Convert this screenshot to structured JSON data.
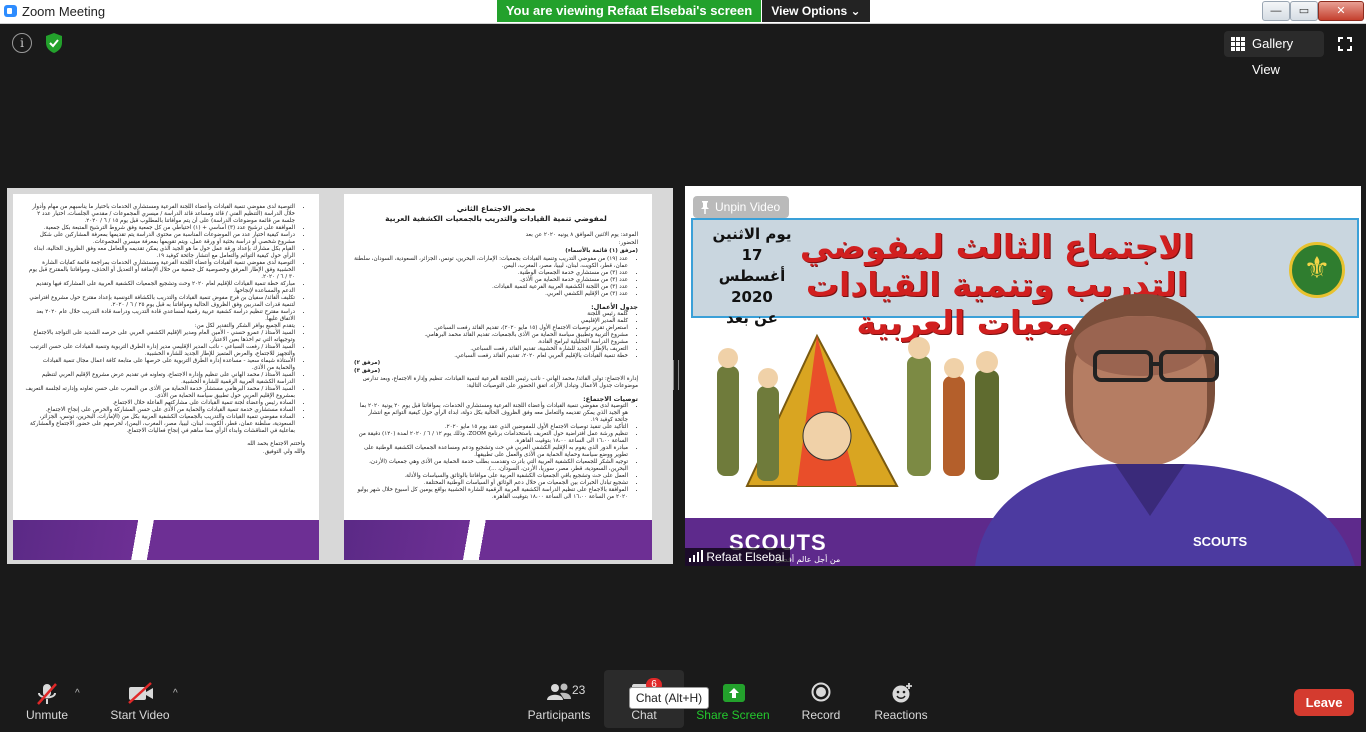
{
  "window": {
    "title": "Zoom Meeting",
    "viewing_banner": "You are viewing Refaat Elsebai's screen",
    "view_options": "View Options",
    "minimize": "—",
    "maximize": "▭",
    "close": "✕"
  },
  "top_bar": {
    "info_glyph": "i",
    "gallery_view": "Gallery View"
  },
  "document": {
    "heading_1": "محضر الاجتماع الثاني",
    "heading_2": "لمفوضي تنمية القيادات والتدريب بالجمعيات الكشفية العربية",
    "topic": "الموعد: يوم الاثنين الموافق ٨ يونيه ٢٠٢٠ عن بعد",
    "attendance": "الحضور:",
    "attachment_1": "(مرفق (١) قائمة بالأسماء)",
    "attendance_items": [
      "عدد (١٩) من مفوضي التدريب وتنمية القيادات بجمعيات: الإمارات، البحرين، تونس، الجزائر، السعودية، السودان، سلطنة عمان، قطر، الكويت، لبنان، ليبيا، مصر، المغرب، اليمن.",
      "عدد (٣) من مستشاري خدمة الجمعيات الوطنية.",
      "عدد (٣) من مستشاري خدمة الحماية من الأذى.",
      "عدد (٣) من اللجنة الكشفية العربية الفرعية لتنمية القيادات.",
      "عدد (٣) من الإقليم الكشفي العربي."
    ],
    "agenda_title": "جدول الأعمال:",
    "agenda_items": [
      "كلمة رئيس اللجنة",
      "كلمة المدير الإقليمي",
      "استعراض تقرير توصيات الاجتماع الأول (١٥ مايو ٢٠٢٠)، تقديم القائد رفعت السباعي.",
      "مشروع التربية وتطبيق سياسة الحماية من الأذى بالجمعيات، تقديم القائد محمد البرهامي.",
      "مشروع الدراسة التحليلية لبرامج القادة.",
      "التعريف بالإطار الجديد للشارة الخشبية، تقديم القائد رفعت السباعي.",
      "خطة تنمية القيادات بالإقليم العربي لعام ٢٠٢٠، تقديم القائد رفعت السباعي."
    ],
    "attachment_2": "(مرفق ٢)",
    "attachment_3": "(مرفق ٣)",
    "management_note": "إدارة الاجتماع: تولى القائد/ محمد الهاني - نائب رئيس اللجنة الفرعية لتنمية القيادات، تنظيم وإدارة الاجتماع، وبعد تدارس موضوعات جدول الأعمال وتبادل الآراء، اتفق الحضور على التوصيات التالية:",
    "recommendations_title": "توصيات الاجتماع:",
    "recommendations": [
      "التوصية لدى مفوضي تنمية القيادات وأعضاء اللجنة الفرعية ومستشاري الخدمات، بموافاتنا قبل يوم ٢٠ يونية ٢٠٢٠ بما هو الجيد الذي يمكن تقديمه والتعامل معه وفق الظروف الحالية بكل دولة، ابداء الرأي حول كيفية التوائم مع انتشار جائحة كوفيد ١٩.",
      "التأكيد على تنفيذ توصيات الاجتماع الأول للمفوضين الذي عقد يوم ١٥ مايو ٢٠٢٠.",
      "تنظيم ورشة عمل افتراضية حول التعريف باستخدامات برنامج ZOOM، وذلك يوم ١٢ / ٦ / ٢٠٢٠ لمدة (١٢٠) دقيقة من الساعة ١٦،٠٠ الى الساعة ١٨،٠٠ بتوقيت القاهرة.",
      "مبادرة الدور الذي يقوم به الإقليم الكشفي العربي في حث وتشجيع ودعم ومساعدة الجمعيات الكشفية الوطنية على تطوير ووضع سياسة وحماية الحماية من الأذى والعمل على تطبيقها.",
      "توجيه الشكر للجمعيات الكشفية العربية التي بادرت وتقدمت بطلب خدمة الحماية من الأذى وهي جمعيات (الأردن، البحرين، السعودية، قطر، مصر، سوريا، الأردن، السودان، ...).",
      "العمل على حث وتشجيع باقي الجمعيات الكشفية العربية على موافاتنا بالوثائق والسياسات والأدلة.",
      "تشجيع تبادل الخبرات بين الجمعيات من خلال دعم الوثائق أو السياسات الوطنية المختلفة.",
      "الموافقة بالاجماع على تنظيم الدراسة الكشفية العربية الرقمية للشارة الخشبية بواقع يومين كل أسبوع خلال شهر يوليو ٢٠٢٠ من الساعة ١٦،٠٠ الى الساعة ١٨،٠٠ بتوقيت القاهرة."
    ],
    "left_items": [
      "التوصية لدى مفوضي تنمية القيادات وأعضاء اللجنة الفرعية ومستشاري الخدمات باختيار ما يناسبهم من مهام وأدوار خلال الدراسة (التنظيم الفني / قائد ومساعد قائد الدراسة / ميسري المجموعات / مقدمي الجلسات، اختيار عدد ٢ جلسة من قائمة موضوعات الدراسة) على أن يتم موافاتنا بالمطلوب قبل يوم ١٥ / ٦ / ٢٠٢٠.",
      "الموافقة على ترشيح عدد (٣) أساسي + (١) احتياطي من كل جمعية وفق شروط الترشيح المتبعة بكل جمعية.",
      "دراسة كيفية اختيار عدد من الموضوعات المناسبة من محتوى الدراسة يتم تقديمها بمعرفة المشاركين على شكل مشروع شخصي أو دراسة بحثية أو ورقة عمل، ويتم تقويمها بمعرفة ميسري المجموعات.",
      "القيام بكل مشارك بإعداد ورقة عمل حول ما هو الجيد الذي يمكن تقديمه والتعامل معه وفق الظروف الحالية، ابداء الرأي حول كيفية التوائم والتعامل مع انتشار جائحة كوفيد ١٩.",
      "التوصية لدى مفوضي تنمية القيادات وأعضاء اللجنة الفرعية ومستشاري الخدمات بمراجعة قائمة كفايات الشارة الخشبية وفق الإطار المرفق وخصوصية كل جمعية من خلال الإضافة أو التعديل أو الحذف، وموافاتنا بالمقترح قبل يوم ٣٠ / ٦ / ٢٠٢٠.",
      "مباركة خطة تنمية القيادات للإقليم لعام ٢٠٢٠ وحث وتشجيع الجمعيات الكشفية العربية على المشاركة فيها وتقديم الدعم والمساعدة لإنجاحها.",
      "تكليف القائد/ سفيان بن فرج مفوض تنمية القيادات والتدريب بالكشافة التونسية بإعداد مقترح حول مشروع افتراضي لتنمية قدرات المدربين وفق الظروف الحالية وموافاتنا به قبل يوم ٢٥ / ٦ / ٢٠٢٠.",
      "دراسة مقترح تنظيم دراسة كشفية عربية رقمية لمساعدي قادة التدريب ودراسة قادة التدريب خلال عام ٢٠٢٠ بعد الاتفاق عليها.",
      "يتقدم الجميع بوافر الشكر والتقدير لكل من:",
      "السيد الأستاذ / عمرو حسني - الأمين العام ومدير الإقليم الكشفي العربي على حرصه الشديد على التواجد بالاجتماع وتوجيهاته التي تم اخذها بعين الاعتبار.",
      "السيد الأستاذ / رفعت السباعي - نائب المدير الإقليمي مدير إدارة الطرق التربوية وتنمية القيادات على حسن الترتيب والتجهيز للاجتماع، والعرض المتميز للإطار الجديد للشارة الخشبية.",
      "الأستاذة شيماء سعيد - مساعدة إدارة الطرق التربوية على حرصها على متابعة كافة اعمال مجال تنمية القيادات والحماية من الأذى.",
      "السيد الأستاذ / محمد الهاني على تنظيم وإدارة الاجتماع، وتعاونه في تقديم عرض مشروع الإقليم العربي لتنظيم الدراسة الكشفية العربية الرقمية للشارة الخشبية.",
      "السيد الأستاذ / محمد البرهامي مستشار خدمة الحماية من الأذى من المغرب على حسن تعاونه وإدارته لجلسة التعريف بمشروع الإقليم العربي حول تطبيق سياسة الحماية من الأذى.",
      "السادة رئيس وأعضاء لجنة تنمية القيادات على مشاركتهم الفاعلة خلال الاجتماع.",
      "السادة مستشاري خدمة تنمية القيادات والحماية من الأذى على حسن المشاركة والحرص على إنجاح الاجتماع.",
      "السادة مفوضي تنمية القيادات والتدريب بالجمعيات الكشفية العربية بكل من (الإمارات، البحرين، تونس، الجزائر، السعودية، سلطنة عمان، قطر، الكويت، لبنان، ليبيا، مصر، المغرب، اليمن)، لحرصهم على حضور الاجتماع والمشاركة بفاعلية في المناقشات وابداء الرأي مما ساهم في إنجاح فعاليات الاجتماع."
    ],
    "closing_1": "واختتم الاجتماع بحمد الله",
    "closing_2": "والله ولي التوفيق."
  },
  "video": {
    "unpin_label": "Unpin Video",
    "participant_name": "Refaat Elsebai",
    "banner_title": "الاجتماع الثالث لمفوضي التدريب وتنمية القيادات بالجمعيات العربية",
    "date_day": "يوم الاثنين",
    "date_date": "17 أغسطس",
    "date_year": "2020",
    "date_mode": "عن بعد",
    "scouts_logo": "SCOUTS",
    "scouts_tagline": "من أجل عالم أفضل",
    "shirt_logo": "SCOUTS"
  },
  "toolbar": {
    "unmute": "Unmute",
    "start_video": "Start Video",
    "participants_count": "23",
    "participants": "Participants",
    "chat": "Chat",
    "chat_badge": "6",
    "chat_tooltip": "Chat (Alt+H)",
    "share_screen": "Share Screen",
    "record": "Record",
    "reactions": "Reactions",
    "leave": "Leave"
  },
  "colors": {
    "banner_green": "#23a12c",
    "leave_red": "#d43b2f",
    "scouts_purple": "#5e2a8c",
    "meeting_bg": "#1a1a1a"
  }
}
